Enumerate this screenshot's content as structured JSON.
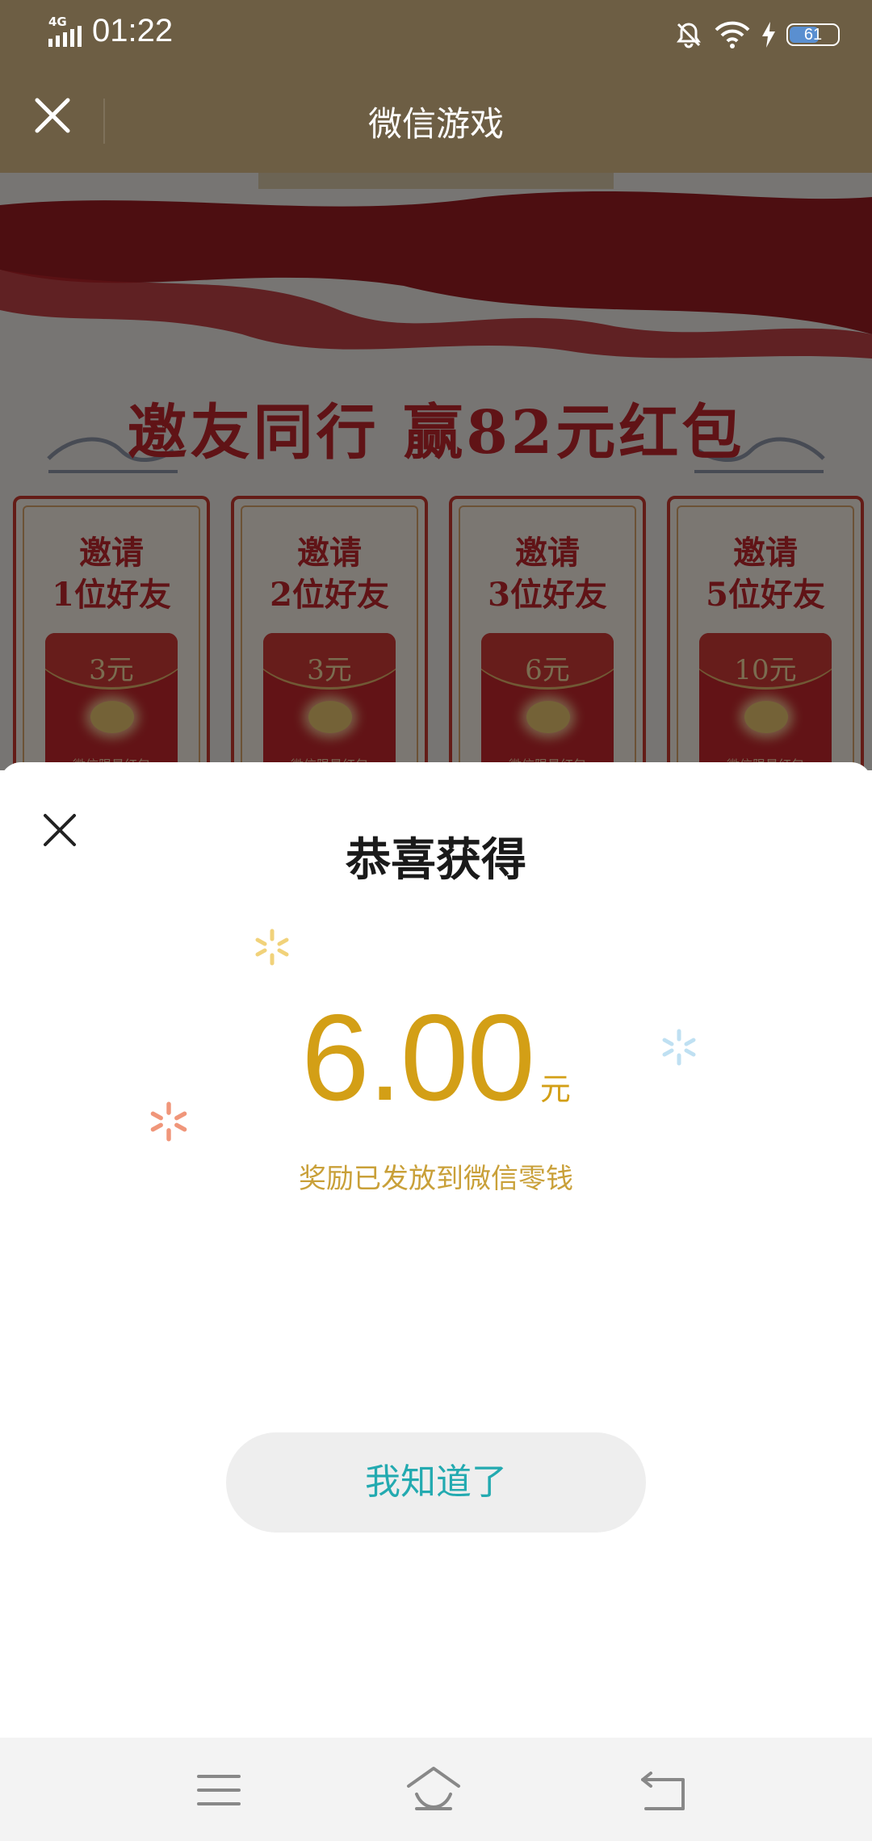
{
  "status_bar": {
    "network": "4G",
    "time": "01:22",
    "battery_level": "61",
    "icons": [
      "signal-icon",
      "mute-icon",
      "wifi-icon",
      "charging-icon",
      "battery-icon"
    ]
  },
  "titlebar": {
    "title": "微信游戏",
    "close_icon": "close-icon"
  },
  "promo": {
    "headline": "邀友同行 赢82元红包",
    "cards": [
      {
        "line1": "邀请",
        "line2": "1位好友",
        "amount": "3元",
        "footer": "微信限量红包"
      },
      {
        "line1": "邀请",
        "line2": "2位好友",
        "amount": "3元",
        "footer": "微信限量红包"
      },
      {
        "line1": "邀请",
        "line2": "3位好友",
        "amount": "6元",
        "footer": "微信限量红包"
      },
      {
        "line1": "邀请",
        "line2": "5位好友",
        "amount": "10元",
        "footer": "微信限量红包"
      }
    ]
  },
  "reward_sheet": {
    "title": "恭喜获得",
    "amount": "6.00",
    "unit": "元",
    "message": "奖励已发放到微信零钱",
    "confirm_label": "我知道了",
    "colors": {
      "amount": "#d39f16",
      "button_text": "#23aab0"
    }
  },
  "nav_bar": {
    "icons": [
      "menu-icon",
      "home-icon",
      "back-icon"
    ]
  }
}
